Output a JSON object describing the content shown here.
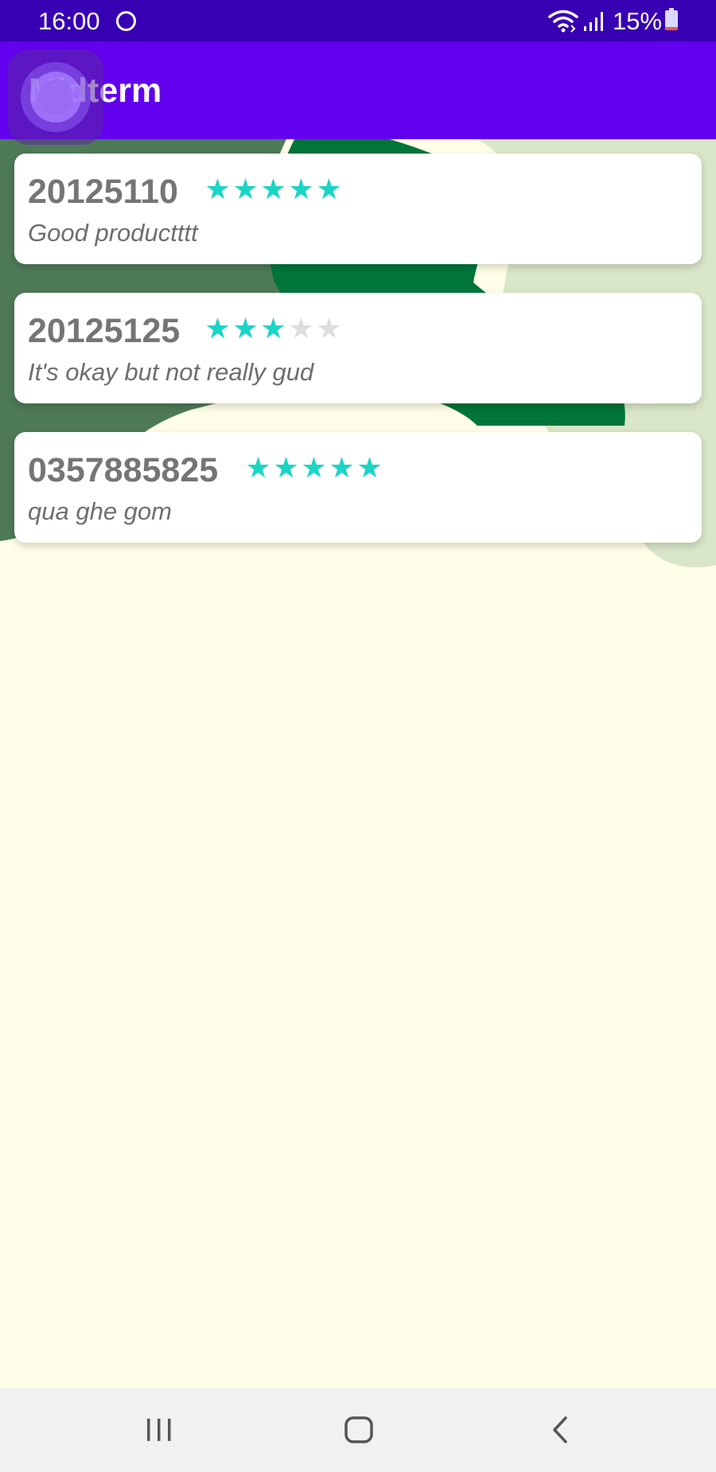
{
  "status_bar": {
    "time": "16:00",
    "battery_percent": "15%",
    "battery_level": 0.15,
    "icons": [
      "sync-ring-icon",
      "wifi-icon",
      "signal-icon",
      "battery-icon"
    ]
  },
  "app_bar": {
    "title": "Midterm"
  },
  "reviews": [
    {
      "id": "20125110",
      "rating": 5,
      "max_rating": 5,
      "comment": "Good productttt"
    },
    {
      "id": "20125125",
      "rating": 3,
      "max_rating": 5,
      "comment": "It's okay but not really gud"
    },
    {
      "id": "0357885825",
      "rating": 5,
      "max_rating": 5,
      "comment": "qua ghe gom"
    }
  ],
  "nav_bar": {
    "buttons": [
      "recent-apps-icon",
      "home-icon",
      "back-icon"
    ]
  },
  "colors": {
    "status_bar": "#3700b3",
    "app_bar": "#6200ee",
    "background": "#fffee8",
    "star_filled": "#1ad5c5",
    "star_empty": "#dddddd",
    "dark_green": "#00753a",
    "muted_green": "#4e7a58",
    "light_green": "#d9e6c8"
  }
}
